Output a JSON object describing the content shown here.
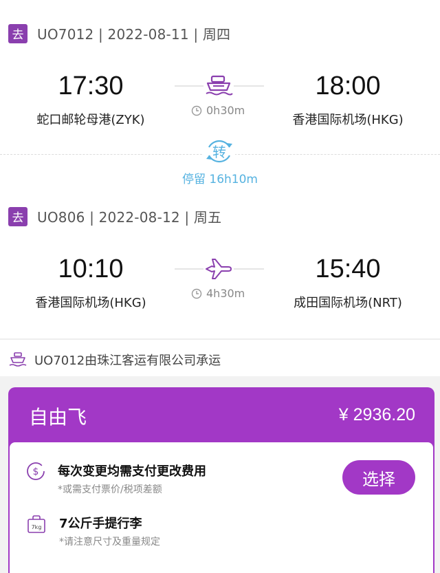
{
  "segments": [
    {
      "badge": "去",
      "info": "UO7012 | 2022-08-11 | 周四",
      "depart_time": "17:30",
      "depart_station": "蛇口邮轮母港(ZYK)",
      "arrive_time": "18:00",
      "arrive_station": "香港国际机场(HKG)",
      "duration": "0h30m",
      "mode_icon": "ship-icon"
    },
    {
      "badge": "去",
      "info": "UO806 | 2022-08-12 | 周五",
      "depart_time": "10:10",
      "depart_station": "香港国际机场(HKG)",
      "arrive_time": "15:40",
      "arrive_station": "成田国际机场(NRT)",
      "duration": "4h30m",
      "mode_icon": "airplane-icon"
    }
  ],
  "transfer": {
    "label": "转",
    "layover": "停留 16h10m"
  },
  "carrier_note": "UO7012由珠江客运有限公司承运",
  "fare": {
    "name": "自由飞",
    "price": "¥ 2936.20",
    "select_label": "选择",
    "rules": [
      {
        "icon": "fee-dollar-icon",
        "title": "每次变更均需支付更改费用",
        "note": "*或需支付票价/税项差额"
      },
      {
        "icon": "baggage-7kg-icon",
        "icon_text": "7kg",
        "title": "7公斤手提行李",
        "note": "*请注意尺寸及重量规定"
      }
    ]
  },
  "colors": {
    "accent": "#a238c6",
    "transfer_blue": "#55b2e0"
  }
}
